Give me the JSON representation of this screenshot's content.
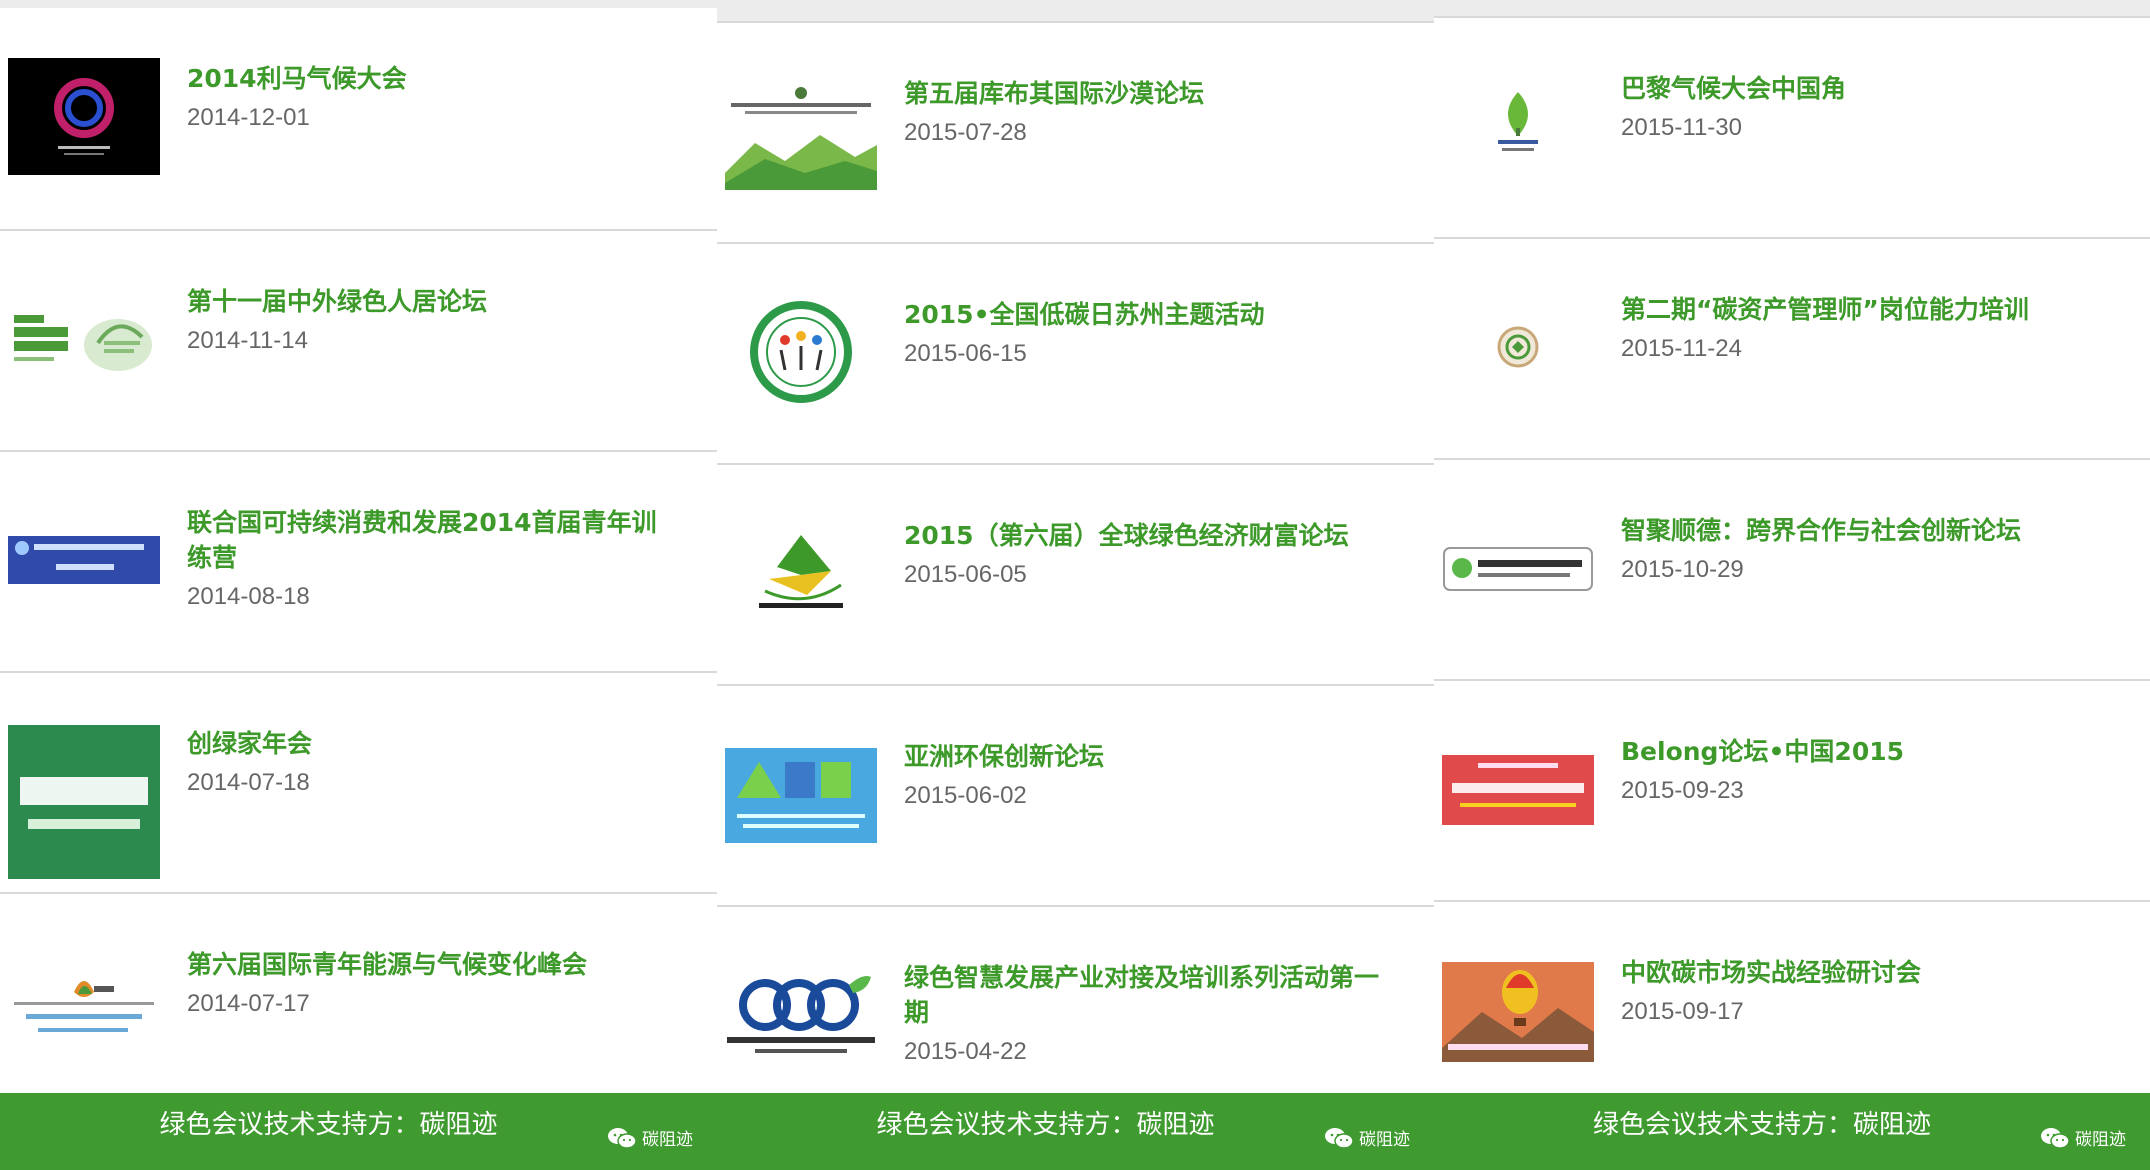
{
  "columns": [
    {
      "items": [
        {
          "title": "2014利马气候大会",
          "date": "2014-12-01",
          "thumb": "cop20-logo"
        },
        {
          "title": "第十一届中外绿色人居论坛",
          "date": "2014-11-14",
          "thumb": "green-habitat-logo"
        },
        {
          "title": "联合国可持续消费和发展2014首届青年训练营",
          "date": "2014-08-18",
          "thumb": "youth-camp-banner"
        },
        {
          "title": "创绿家年会",
          "date": "2014-07-18",
          "thumb": "chuanglvjia-logo"
        },
        {
          "title": "第六届国际青年能源与气候变化峰会",
          "date": "2014-07-17",
          "thumb": "iysecc-logo"
        }
      ]
    },
    {
      "items": [
        {
          "title": "第五届库布其国际沙漠论坛",
          "date": "2015-07-28",
          "thumb": "kubuqi-forum-banner"
        },
        {
          "title": "2015•全国低碳日苏州主题活动",
          "date": "2015-06-15",
          "thumb": "low-carbon-day-logo"
        },
        {
          "title": "2015（第六届）全球绿色经济财富论坛",
          "date": "2015-06-05",
          "thumb": "green-economy-forum-logo"
        },
        {
          "title": "亚洲环保创新论坛",
          "date": "2015-06-02",
          "thumb": "aeif-logo"
        },
        {
          "title": "绿色智慧发展产业对接及培训系列活动第一期",
          "date": "2015-04-22",
          "thumb": "teda-eco-logo"
        }
      ]
    },
    {
      "items": [
        {
          "title": "巴黎气候大会中国角",
          "date": "2015-11-30",
          "thumb": "paris2015-logo"
        },
        {
          "title": "第二期“碳资产管理师”岗位能力培训",
          "date": "2015-11-24",
          "thumb": "carbon-asset-seal"
        },
        {
          "title": "智聚顺德：跨界合作与社会创新论坛",
          "date": "2015-10-29",
          "thumb": "shunde-innovation-logo"
        },
        {
          "title": "Belong论坛•中国2015",
          "date": "2015-09-23",
          "thumb": "belong-forum-banner"
        },
        {
          "title": "中欧碳市场实战经验研讨会",
          "date": "2015-09-17",
          "thumb": "balloon-seminar-banner"
        }
      ]
    }
  ],
  "footer": {
    "support_text": "绿色会议技术支持方：碳阻迹",
    "wechat_label": "碳阻迹",
    "wechat_icon": "wechat-icon"
  },
  "colors": {
    "title_green": "#3d9a2a",
    "footer_green": "#3f9a30",
    "date_gray": "#666666"
  }
}
